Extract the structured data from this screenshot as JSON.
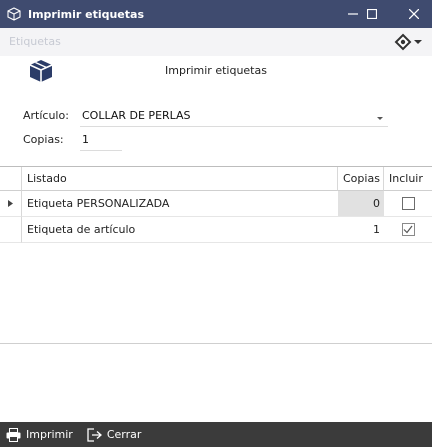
{
  "window": {
    "title": "Imprimir etiquetas"
  },
  "tabs": [
    {
      "label": "Etiquetas"
    }
  ],
  "form": {
    "heading": "Imprimir etiquetas",
    "articulo": {
      "label": "Artículo:",
      "value": "COLLAR DE PERLAS"
    },
    "copias": {
      "label": "Copias:",
      "value": "1"
    }
  },
  "table": {
    "columns": [
      "Listado",
      "Copias",
      "Incluir"
    ],
    "rows": [
      {
        "listado": "Etiqueta PERSONALIZADA",
        "copias": "0",
        "incluir": false,
        "current": true
      },
      {
        "listado": "Etiqueta de artículo",
        "copias": "1",
        "incluir": true,
        "current": false
      }
    ]
  },
  "footer": {
    "print_label": "Imprimir",
    "close_label": "Cerrar"
  },
  "colors": {
    "titlebar": "#3f4b6f",
    "footer": "#3b3b3b",
    "logo": "#2b3c68"
  }
}
